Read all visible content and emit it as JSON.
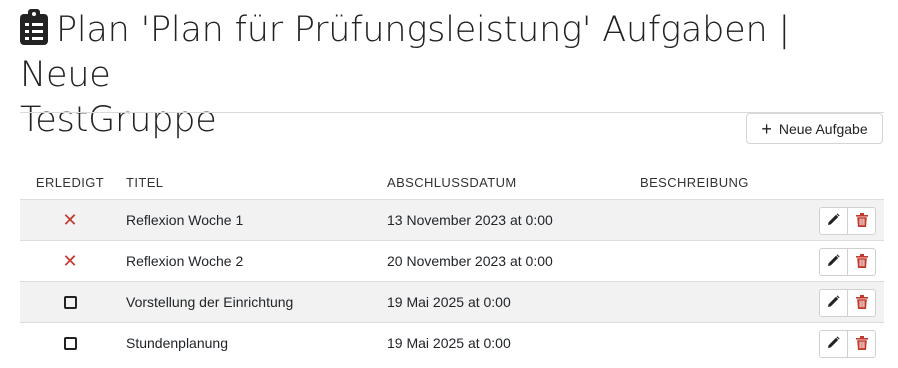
{
  "page": {
    "title_line1": "Plan 'Plan für Prüfungsleistung' Aufgaben | Neue",
    "title_line2": "TestGruppe",
    "title_icon": "clipboard-list-icon"
  },
  "toolbar": {
    "add_label": "Neue Aufgabe",
    "add_icon": "plus-icon"
  },
  "table": {
    "headers": {
      "done": "ERLEDIGT",
      "title": "TITEL",
      "date": "ABSCHLUSSDATUM",
      "description": "BESCHREIBUNG"
    },
    "rows": [
      {
        "done_state": "x-mark",
        "title": "Reflexion Woche 1",
        "date": "13 November 2023 at 0:00",
        "description": ""
      },
      {
        "done_state": "x-mark",
        "title": "Reflexion Woche 2",
        "date": "20 November 2023 at 0:00",
        "description": ""
      },
      {
        "done_state": "checkbox",
        "title": "Vorstellung der Einrichtung",
        "date": "19 Mai 2025 at 0:00",
        "description": ""
      },
      {
        "done_state": "checkbox",
        "title": "Stundenplanung",
        "date": "19 Mai 2025 at 0:00",
        "description": ""
      }
    ],
    "x_glyph": "✕",
    "row_actions": {
      "edit_icon": "pencil-icon",
      "delete_icon": "trash-icon"
    }
  },
  "colors": {
    "delete": "#c0392b",
    "row_stripe": "#f2f2f2",
    "x_mark": "#c0392b"
  }
}
